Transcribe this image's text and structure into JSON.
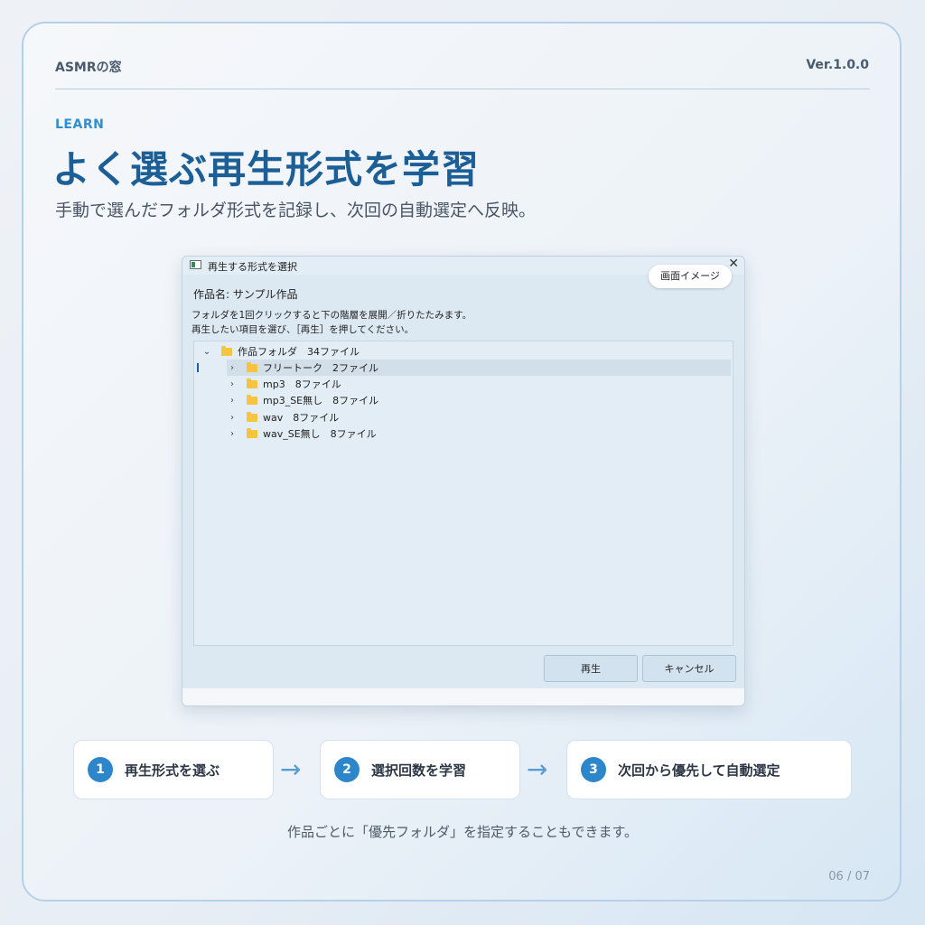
{
  "header": {
    "brand": "ASMRの窓",
    "version": "Ver.1.0.0"
  },
  "section": {
    "eyebrow": "LEARN",
    "title": "よく選ぶ再生形式を学習",
    "subtitle": "手動で選んだフォルダ形式を記録し、次回の自動選定へ反映。"
  },
  "dialog": {
    "title": "再生する形式を選択",
    "badge": "画面イメージ",
    "work_name": "作品名: サンプル作品",
    "instructions": [
      "フォルダを1回クリックすると下の階層を展開／折りたたみます。",
      "再生したい項目を選び、［再生］を押してください。"
    ],
    "tree": {
      "root": {
        "label": "作品フォルダ　34ファイル",
        "expanded": true
      },
      "children": [
        {
          "label": "フリートーク　2ファイル",
          "selected": true
        },
        {
          "label": "mp3　8ファイル",
          "selected": false
        },
        {
          "label": "mp3_SE無し　8ファイル",
          "selected": false
        },
        {
          "label": "wav　8ファイル",
          "selected": false
        },
        {
          "label": "wav_SE無し　8ファイル",
          "selected": false
        }
      ]
    },
    "buttons": {
      "play": "再生",
      "cancel": "キャンセル"
    }
  },
  "steps": [
    {
      "number": "1",
      "label": "再生形式を選ぶ"
    },
    {
      "number": "2",
      "label": "選択回数を学習"
    },
    {
      "number": "3",
      "label": "次回から優先して自動選定"
    }
  ],
  "note": "作品ごとに「優先フォルダ」を指定することもできます。",
  "pager": "06 / 07",
  "colors": {
    "accent": "#2c86c9",
    "title": "#1c5e96",
    "folder": "#f5c542"
  }
}
